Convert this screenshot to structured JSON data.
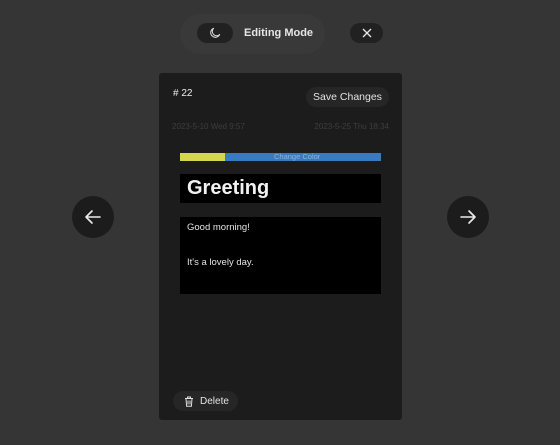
{
  "header": {
    "mode_label": "Editing Mode",
    "theme_icon": "moon-icon",
    "close_icon": "close-icon"
  },
  "note": {
    "number": "# 22",
    "save_label": "Save Changes",
    "created": "2023-5-10 Wed 9:57",
    "modified": "2023-5-25 Thu 18:34",
    "color_label": "Change Color",
    "accent_color": "#d5d64c",
    "bar_color": "#3a7bbf",
    "title": "Greeting",
    "body_line1": "Good morning!",
    "body_line2": "It's a lovely day.",
    "delete_label": "Delete",
    "delete_icon": "trash-icon"
  },
  "navigation": {
    "prev_icon": "arrow-left-icon",
    "next_icon": "arrow-right-icon"
  }
}
